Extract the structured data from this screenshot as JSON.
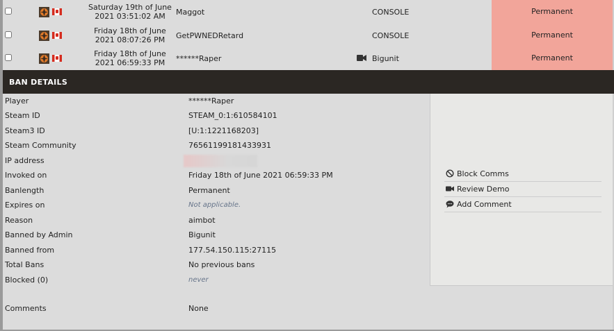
{
  "rows": [
    {
      "date_line1": "Saturday 19th of June",
      "date_line2": "2021 03:51:02 AM",
      "name": "Maggot",
      "admin": "CONSOLE",
      "length": "Permanent",
      "has_demo": false
    },
    {
      "date_line1": "Friday 18th of June",
      "date_line2": "2021 08:07:26 PM",
      "name": "GetPWNEDRetard",
      "admin": "CONSOLE",
      "length": "Permanent",
      "has_demo": false
    },
    {
      "date_line1": "Friday 18th of June",
      "date_line2": "2021 06:59:33 PM",
      "name": "******Raper",
      "admin": "Bigunit",
      "length": "Permanent",
      "has_demo": true
    }
  ],
  "details": {
    "title": "BAN DETAILS",
    "fields": [
      {
        "label": "Player",
        "value": "******Raper"
      },
      {
        "label": "Steam ID",
        "value": "STEAM_0:1:610584101"
      },
      {
        "label": "Steam3 ID",
        "value": "[U:1:1221168203]"
      },
      {
        "label": "Steam Community",
        "value": "76561199181433931"
      },
      {
        "label": "IP address",
        "value": ""
      },
      {
        "label": "Invoked on",
        "value": "Friday 18th of June 2021 06:59:33 PM"
      },
      {
        "label": "Banlength",
        "value": "Permanent"
      },
      {
        "label": "Expires on",
        "value": "Not applicable."
      },
      {
        "label": "Reason",
        "value": "aimbot"
      },
      {
        "label": "Banned by Admin",
        "value": "Bigunit"
      },
      {
        "label": "Banned from",
        "value": "177.54.150.115:27115"
      },
      {
        "label": "Total Bans",
        "value": "No previous bans"
      },
      {
        "label": "Blocked (0)",
        "value": "never"
      },
      {
        "label": "Comments",
        "value": "None"
      }
    ]
  },
  "actions": [
    {
      "label": "Block Comms",
      "icon": "block-icon"
    },
    {
      "label": "Review Demo",
      "icon": "video-camera-icon"
    },
    {
      "label": "Add Comment",
      "icon": "comment-icon"
    }
  ],
  "colors": {
    "permanent_bg": "#f2a59a",
    "header_bg": "#2b2723"
  }
}
